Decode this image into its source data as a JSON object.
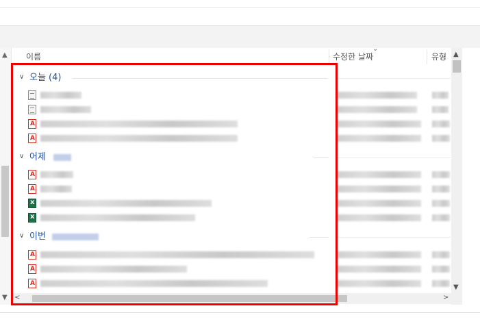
{
  "columns": {
    "name": "이름",
    "modified": "수정한 날짜",
    "type": "유형"
  },
  "groups": [
    {
      "title": "오늘 (4)"
    },
    {
      "title": "어제"
    },
    {
      "title": "이번"
    }
  ],
  "icons": {
    "pdf": "pdf-file-icon",
    "doc": "document-file-icon",
    "xls": "excel-file-icon"
  },
  "colors": {
    "highlight": "#ee0000",
    "group_title": "#1e4e99",
    "pdf": "#d22a1f",
    "excel": "#1e7145"
  }
}
